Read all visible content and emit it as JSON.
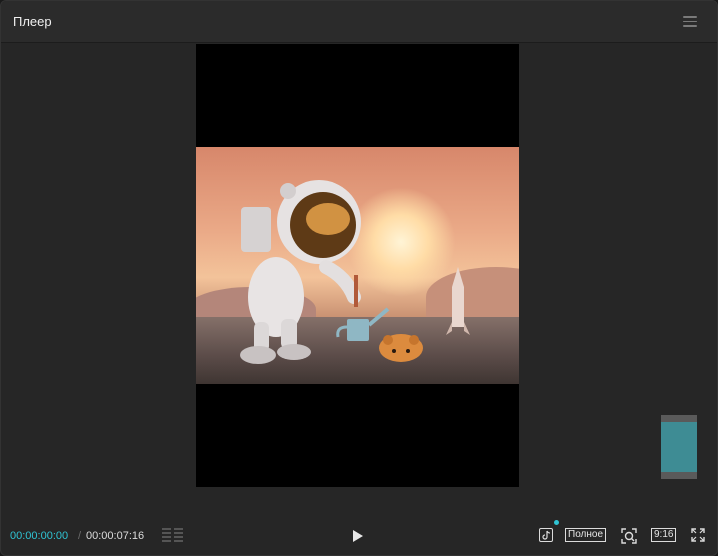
{
  "header": {
    "title": "Плеер",
    "menu_icon": "hamburger-menu-icon"
  },
  "video": {
    "scene_description_icon": "video-frame-astronaut-planting",
    "preview_color": "#3e8c94"
  },
  "controls": {
    "current_time": "00:00:00:00",
    "separator": "/",
    "total_time": "00:00:07:16",
    "fit_label": "Полное",
    "ratio_label": "9:16",
    "accent_color": "#2fc4d4"
  }
}
